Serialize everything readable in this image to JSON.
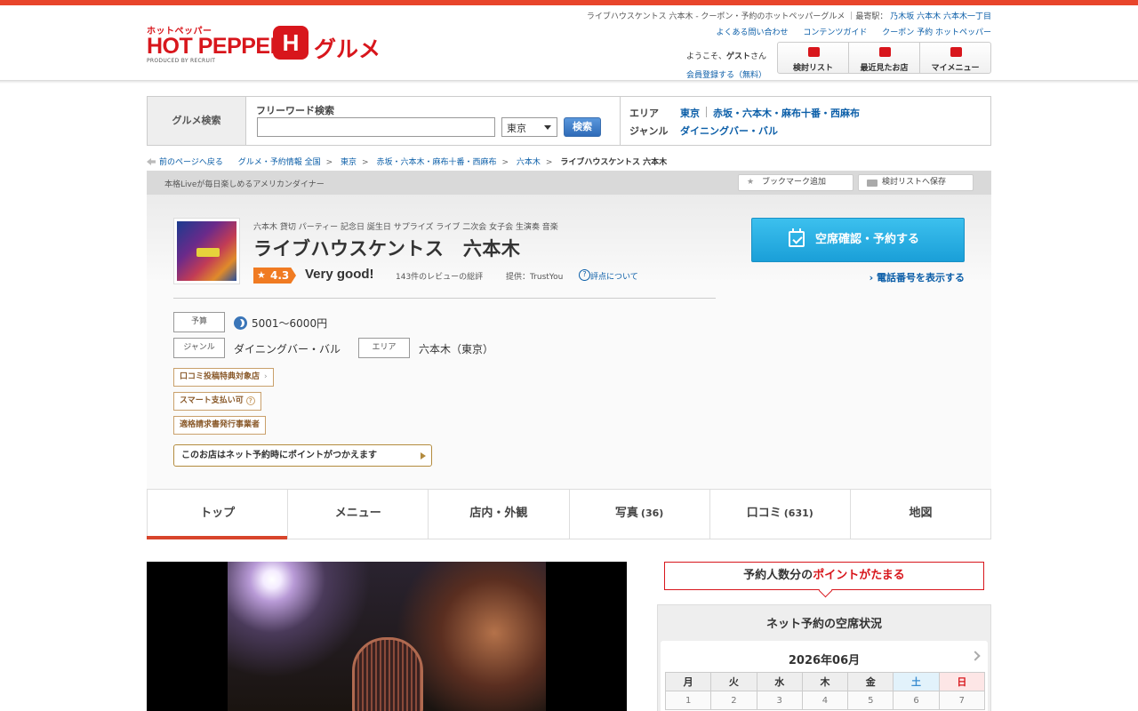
{
  "header": {
    "logo_kana": "ホットペッパー",
    "logo_main": "HOT PEPPER",
    "logo_h": "H",
    "logo_gourmet": "グルメ",
    "logo_sub": "PRODUCED BY RECRUIT",
    "page_title_text": "ライブハウスケントス 六本木 - クーポン・予約のホットペッパーグルメ",
    "station_label": "最寄駅：",
    "stations": [
      "乃木坂",
      "六本木",
      "六本木一丁目"
    ],
    "links": [
      "よくある問い合わせ",
      "コンテンツガイド",
      "クーポン 予約 ホットペッパー"
    ],
    "welcome_prefix": "ようこそ、",
    "welcome_name": "ゲスト",
    "welcome_suffix": "さん",
    "register": "会員登録する（無料）",
    "nav": [
      "検討リスト",
      "最近見たお店",
      "マイメニュー"
    ]
  },
  "search": {
    "label": "グルメ検索",
    "freeword_label": "フリーワード検索",
    "freeword_value": "",
    "pref_selected": "東京",
    "button": "検索",
    "area_key": "エリア",
    "area_values": [
      "東京",
      "赤坂・六本木・麻布十番・西麻布"
    ],
    "genre_key": "ジャンル",
    "genre_value": "ダイニングバー・バル"
  },
  "breadcrumb": {
    "back": "前のページへ戻る",
    "items": [
      "グルメ・予約情報 全国",
      "東京",
      "赤坂・六本木・麻布十番・西麻布",
      "六本木"
    ],
    "current": "ライブハウスケントス 六本木"
  },
  "shopbar": {
    "catch": "本格Liveが毎日楽しめるアメリカンダイナー",
    "bookmark": "ブックマーク追加",
    "save_list": "検討リストへ保存"
  },
  "shop": {
    "tags": "六本木 貸切 パーティー 記念日 誕生日 サプライズ ライブ 二次会 女子会 生演奏 音楽",
    "name": "ライブハウスケントス　六本木",
    "rating": "4.3",
    "rating_word": "Very good!",
    "review_summary": "143件のレビューの総評",
    "provider": "提供：TrustYou",
    "score_about": "評点について",
    "budget_label": "予算",
    "budget_value": "5001～6000円",
    "genre_label": "ジャンル",
    "genre_value": "ダイニングバー・バル",
    "area_label": "エリア",
    "area_value": "六本木（東京）",
    "badges": [
      "口コミ投稿特典対象店",
      "スマート支払い可",
      "適格請求書発行事業者"
    ],
    "point_text": "このお店はネット予約時にポイントがつかえます",
    "reserve_button": "空席確認・予約する",
    "tel_link": "電話番号を表示する"
  },
  "tabs": [
    {
      "label": "トップ",
      "count": ""
    },
    {
      "label": "メニュー",
      "count": ""
    },
    {
      "label": "店内・外観",
      "count": ""
    },
    {
      "label": "写真",
      "count": "(36)"
    },
    {
      "label": "口コミ",
      "count": "(631)"
    },
    {
      "label": "地図",
      "count": ""
    }
  ],
  "side": {
    "banner_prefix": "予約人数分の",
    "banner_red": "ポイントがたまる",
    "vacancy_title": "ネット予約の空席状況",
    "month": "2026年06月",
    "weekdays": [
      "月",
      "火",
      "水",
      "木",
      "金",
      "土",
      "日"
    ],
    "days": [
      "1",
      "2",
      "3",
      "4",
      "5",
      "6",
      "7"
    ]
  },
  "colors": {
    "brand_red": "#d8161c",
    "link_blue": "#0b5ea8",
    "reserve_blue": "#1a9fd8",
    "rating_orange": "#f07b22"
  }
}
